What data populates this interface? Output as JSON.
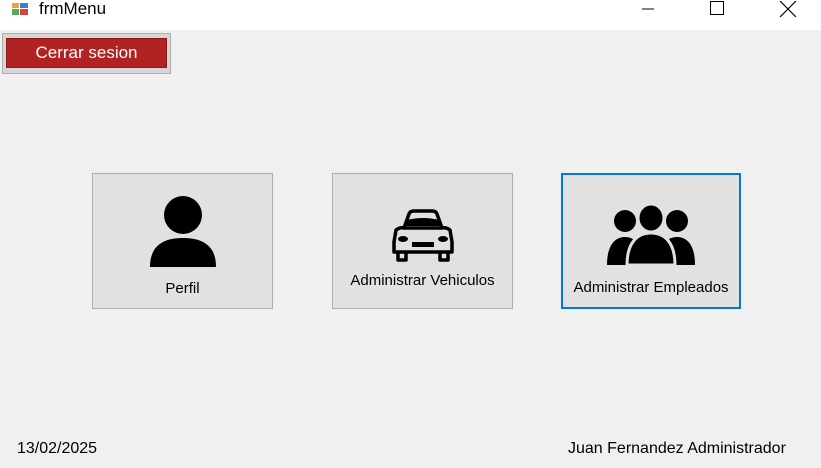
{
  "window": {
    "title": "frmMenu",
    "controls": {
      "minimize_icon": "minimize-icon",
      "maximize_icon": "maximize-icon",
      "close_icon": "close-icon"
    }
  },
  "toolbar": {
    "logout_label": "Cerrar sesion",
    "logout_color": "#b22222"
  },
  "menu": {
    "tiles": [
      {
        "label": "Perfil",
        "icon": "person-icon"
      },
      {
        "label": "Administrar Vehiculos",
        "icon": "car-icon"
      },
      {
        "label": "Administrar Empleados",
        "icon": "group-icon",
        "focused": true
      }
    ],
    "focus_color": "#0078d7"
  },
  "status": {
    "date": "13/02/2025",
    "user": "Juan Fernandez Administrador"
  }
}
